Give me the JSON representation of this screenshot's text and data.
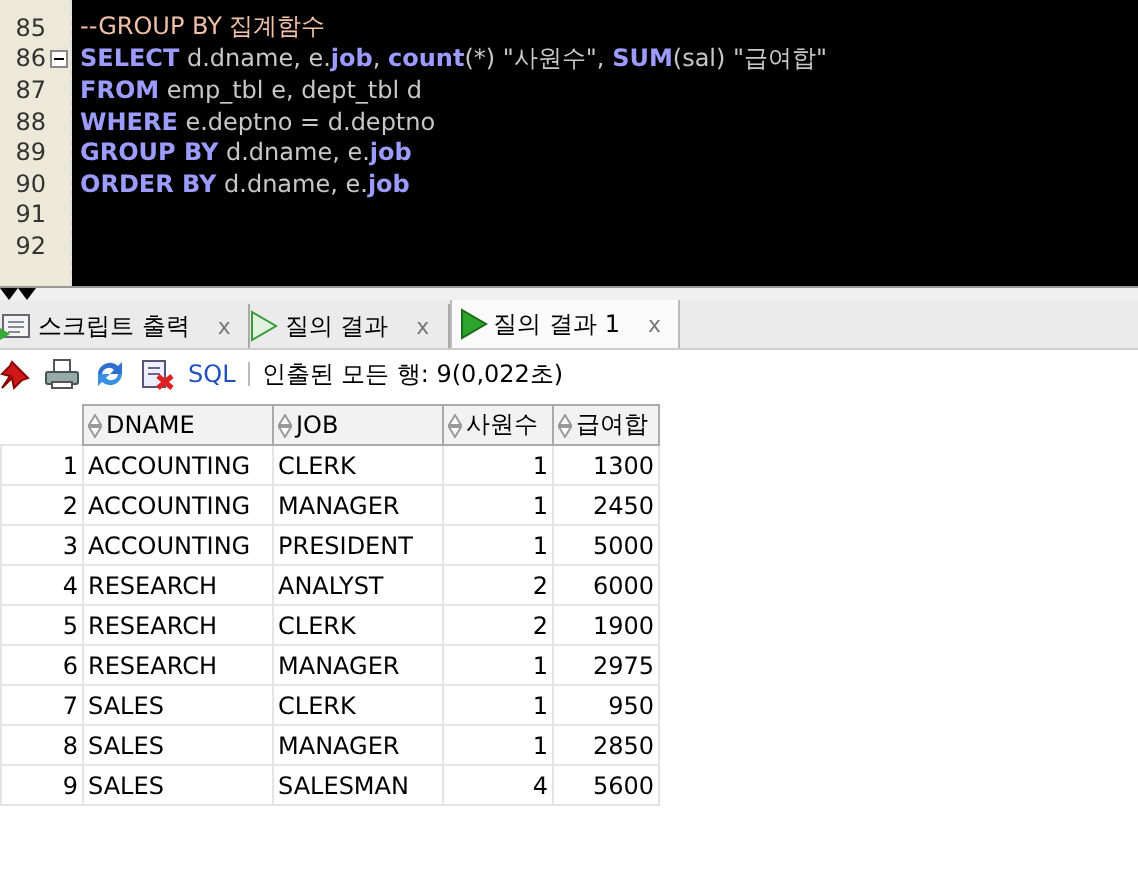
{
  "editor": {
    "lines": [
      {
        "number": "85",
        "fold": false,
        "tokens": [
          {
            "kind": "comment",
            "text": "--GROUP BY 집계함수"
          }
        ]
      },
      {
        "number": "86",
        "fold": true,
        "tokens": [
          {
            "kind": "keyword",
            "text": "SELECT"
          },
          {
            "kind": "text",
            "text": " d.dname, e."
          },
          {
            "kind": "keyword",
            "text": "job"
          },
          {
            "kind": "text",
            "text": ", "
          },
          {
            "kind": "keyword",
            "text": "count"
          },
          {
            "kind": "text",
            "text": "(*) \"사원수\", "
          },
          {
            "kind": "keyword",
            "text": "SUM"
          },
          {
            "kind": "text",
            "text": "(sal) \"급여합\""
          }
        ]
      },
      {
        "number": "87",
        "fold": false,
        "tokens": [
          {
            "kind": "keyword",
            "text": "FROM"
          },
          {
            "kind": "text",
            "text": " emp_tbl e, dept_tbl d"
          }
        ]
      },
      {
        "number": "88",
        "fold": false,
        "tokens": [
          {
            "kind": "keyword",
            "text": "WHERE"
          },
          {
            "kind": "text",
            "text": " e.deptno = d.deptno"
          }
        ]
      },
      {
        "number": "89",
        "fold": false,
        "tokens": [
          {
            "kind": "keyword",
            "text": "GROUP BY"
          },
          {
            "kind": "text",
            "text": " d.dname, e."
          },
          {
            "kind": "keyword",
            "text": "job"
          }
        ]
      },
      {
        "number": "90",
        "fold": false,
        "tokens": [
          {
            "kind": "keyword",
            "text": "ORDER BY"
          },
          {
            "kind": "text",
            "text": " d.dname, e."
          },
          {
            "kind": "keyword",
            "text": "job"
          }
        ]
      },
      {
        "number": "91",
        "fold": false
      },
      {
        "number": "92",
        "fold": false
      }
    ]
  },
  "tabs": [
    {
      "kind": "script",
      "label": "스크립트 출력",
      "close": "x",
      "selected": false
    },
    {
      "kind": "query",
      "label": "질의 결과",
      "close": "x",
      "selected": false
    },
    {
      "kind": "query",
      "label": "질의 결과 1",
      "close": "x",
      "selected": true
    }
  ],
  "toolbar": {
    "sql_link": "SQL",
    "status": "인출된 모든 행: 9(0,022초)"
  },
  "table": {
    "columns": [
      {
        "label": "DNAME"
      },
      {
        "label": "JOB"
      },
      {
        "label": "사원수"
      },
      {
        "label": "급여합"
      }
    ],
    "rows": [
      {
        "number": "1",
        "cells": [
          "ACCOUNTING",
          "CLERK",
          "1",
          "1300"
        ]
      },
      {
        "number": "2",
        "cells": [
          "ACCOUNTING",
          "MANAGER",
          "1",
          "2450"
        ]
      },
      {
        "number": "3",
        "cells": [
          "ACCOUNTING",
          "PRESIDENT",
          "1",
          "5000"
        ]
      },
      {
        "number": "4",
        "cells": [
          "RESEARCH",
          "ANALYST",
          "2",
          "6000"
        ]
      },
      {
        "number": "5",
        "cells": [
          "RESEARCH",
          "CLERK",
          "2",
          "1900"
        ]
      },
      {
        "number": "6",
        "cells": [
          "RESEARCH",
          "MANAGER",
          "1",
          "2975"
        ]
      },
      {
        "number": "7",
        "cells": [
          "SALES",
          "CLERK",
          "1",
          "950"
        ]
      },
      {
        "number": "8",
        "cells": [
          "SALES",
          "MANAGER",
          "1",
          "2850"
        ]
      },
      {
        "number": "9",
        "cells": [
          "SALES",
          "SALESMAN",
          "4",
          "5600"
        ]
      }
    ]
  }
}
